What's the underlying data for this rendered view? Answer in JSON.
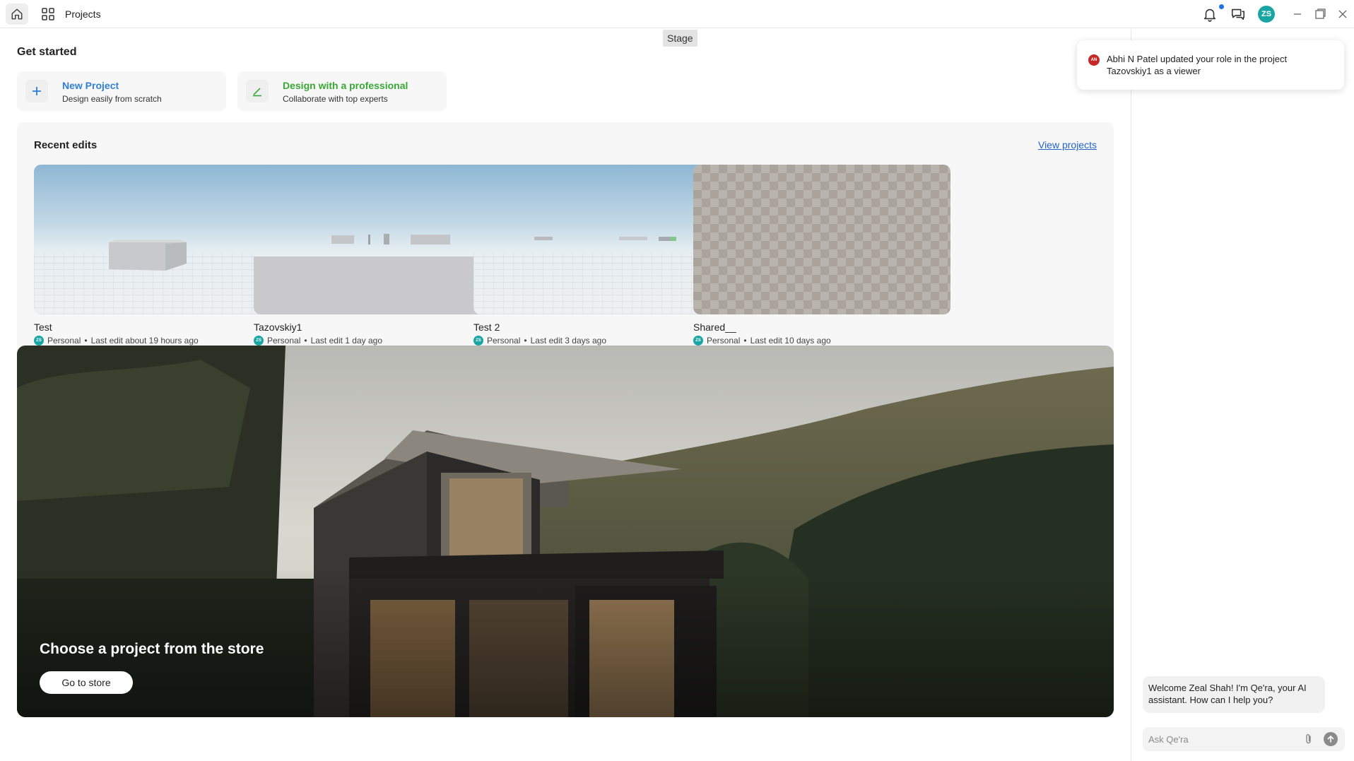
{
  "topbar": {
    "title": "Projects",
    "avatar_initials": "ZS",
    "icons": {
      "home": "home-icon",
      "grid": "grid-icon",
      "notifications": "bell-icon",
      "chat": "chat-icon",
      "minimize": "minimize-icon",
      "maximize": "maximize-icon",
      "close": "close-icon"
    }
  },
  "tooltip": {
    "stage": "Stage"
  },
  "get_started": {
    "title": "Get started",
    "new_project": {
      "title": "New Project",
      "subtitle": "Design easily from scratch",
      "icon": "plus-icon",
      "color": "#2f7fd8"
    },
    "design_pro": {
      "title": "Design with a professional",
      "subtitle": "Collaborate with top experts",
      "icon": "pen-icon",
      "color": "#3aa835"
    }
  },
  "recent": {
    "title": "Recent edits",
    "view_link": "View projects",
    "projects": [
      {
        "name": "Test",
        "owner_initials": "ZS",
        "workspace": "Personal",
        "last_edit": "Last edit about 19 hours ago",
        "preview": "3d-scene-box"
      },
      {
        "name": "Tazovskiy1",
        "owner_initials": "ZS",
        "workspace": "Personal",
        "last_edit": "Last edit 1 day ago",
        "preview": "3d-scene-walls"
      },
      {
        "name": "Test 2",
        "owner_initials": "ZS",
        "workspace": "Personal",
        "last_edit": "Last edit 3 days ago",
        "preview": "3d-scene-flat"
      },
      {
        "name": "Shared__",
        "owner_initials": "ZS",
        "workspace": "Personal",
        "last_edit": "Last edit 10 days ago",
        "preview": "empty-checker"
      }
    ]
  },
  "store": {
    "title": "Choose a project from the store",
    "button": "Go to store",
    "image": "modern-house-in-forest"
  },
  "notification": {
    "initials": "AN",
    "message": "Abhi N Patel updated your role in the project Tazovskiy1 as a viewer"
  },
  "assistant": {
    "welcome": "Welcome Zeal Shah! I'm Qe'ra, your AI assistant. How can I help you?",
    "input_placeholder": "Ask Qe'ra",
    "input_value": ""
  },
  "colors": {
    "accent_teal": "#1aa5a5",
    "link_blue": "#2563c9",
    "notif_red": "#c62828"
  }
}
